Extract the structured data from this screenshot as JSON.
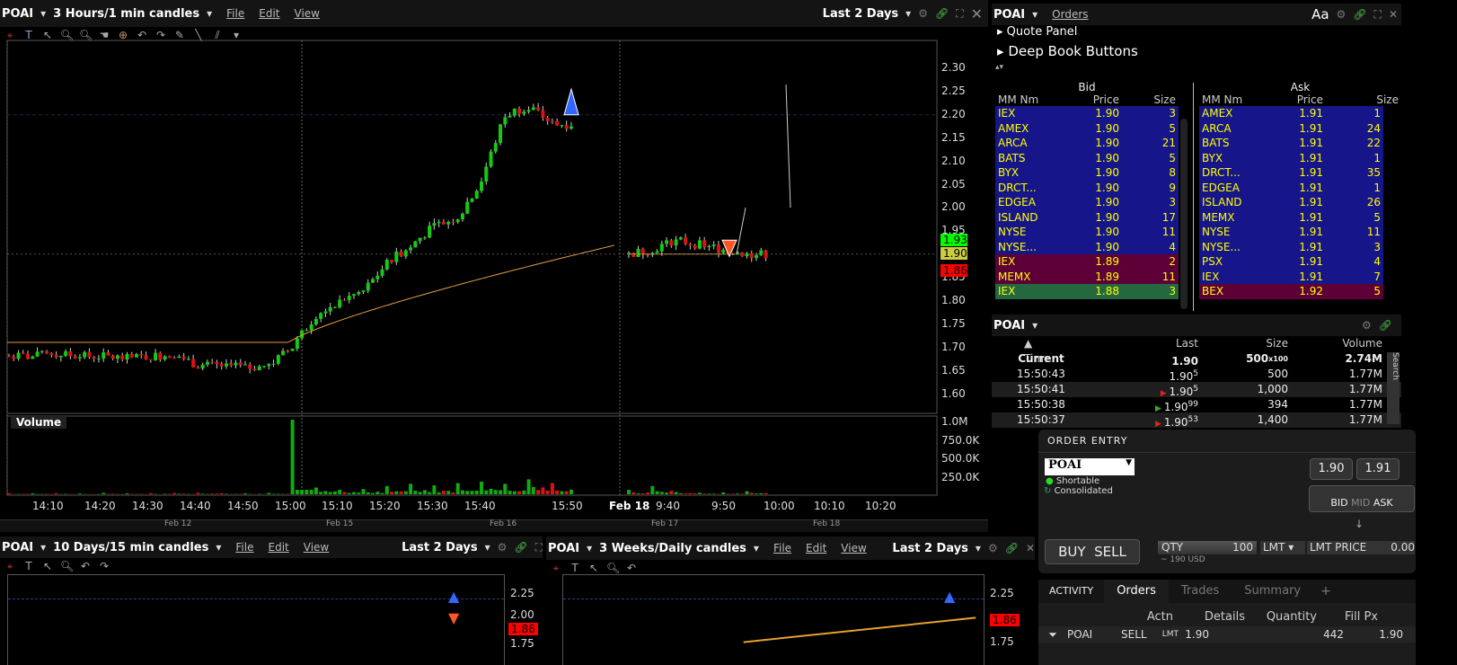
{
  "main_chart": {
    "symbol": "POAI",
    "period": "3 Hours/1 min candles",
    "menu": [
      "File",
      "Edit",
      "View"
    ],
    "range": "Last 2 Days",
    "price_labels": [
      "2.30",
      "2.25",
      "2.20",
      "2.15",
      "2.10",
      "2.05",
      "2.00",
      "1.95",
      "1.90",
      "1.85",
      "1.80",
      "1.75",
      "1.70",
      "1.65",
      "1.60"
    ],
    "tags": {
      "ask": "1.93",
      "last": "1.90",
      "bid": "1.86"
    },
    "volume_label": "Volume",
    "volume_axis": [
      "1.0M",
      "750.0K",
      "500.0K",
      "250.0K"
    ],
    "time_labels": [
      "14:10",
      "14:20",
      "14:30",
      "14:40",
      "14:50",
      "15:00",
      "15:10",
      "15:20",
      "15:30",
      "15:40",
      "15:50",
      "Feb 18",
      "9:40",
      "9:50",
      "10:00",
      "10:10",
      "10:20"
    ],
    "nav_labels": [
      "Feb 12",
      "Feb 15",
      "Feb 16",
      "Feb 17",
      "Feb 18"
    ]
  },
  "chart_data": {
    "type": "candlestick",
    "interval_min": 5,
    "day1": {
      "start": "14:00",
      "closes": [
        1.68,
        1.68,
        1.685,
        1.68,
        1.68,
        1.675,
        1.68,
        1.685,
        1.66,
        1.66,
        1.655,
        1.66,
        1.7,
        1.77,
        1.8,
        1.82,
        1.88,
        1.92,
        1.96,
        1.98,
        2.06,
        2.2,
        2.22,
        2.18
      ]
    },
    "day2": {
      "start": "9:30",
      "closes": [
        1.9,
        1.91,
        1.93,
        1.92,
        1.91,
        1.9
      ]
    },
    "vwap": {
      "day1_start": 1.71,
      "day1_end": 1.92,
      "day2": 1.9
    },
    "volume_k": {
      "day1": [
        15,
        12,
        14,
        10,
        18,
        12,
        14,
        16,
        20,
        14,
        12,
        18,
        1000,
        90,
        60,
        70,
        110,
        140,
        120,
        150,
        170,
        140,
        200,
        150
      ],
      "day2": [
        60,
        110,
        30,
        20,
        25,
        40
      ]
    }
  },
  "book": {
    "symbol": "POAI",
    "orders_link": "Orders",
    "font_btn": "Aa",
    "quote_panel": "Quote Panel",
    "deep_book": "Deep Book Buttons",
    "bid_title": "Bid",
    "ask_title": "Ask",
    "cols": [
      "MM Nm",
      "Price",
      "Size"
    ],
    "bids": [
      [
        "IEX",
        "1.90",
        "3",
        "bl"
      ],
      [
        "AMEX",
        "1.90",
        "5",
        "bl"
      ],
      [
        "ARCA",
        "1.90",
        "21",
        "bl"
      ],
      [
        "BATS",
        "1.90",
        "5",
        "bl"
      ],
      [
        "BYX",
        "1.90",
        "8",
        "bl"
      ],
      [
        "DRCT...",
        "1.90",
        "9",
        "bl"
      ],
      [
        "EDGEA",
        "1.90",
        "3",
        "bl"
      ],
      [
        "ISLAND",
        "1.90",
        "17",
        "bl"
      ],
      [
        "NYSE",
        "1.90",
        "11",
        "bl"
      ],
      [
        "NYSE...",
        "1.90",
        "4",
        "bl"
      ],
      [
        "IEX",
        "1.89",
        "2",
        "mr"
      ],
      [
        "MEMX",
        "1.89",
        "11",
        "mr"
      ],
      [
        "IEX",
        "1.88",
        "3",
        "gr"
      ]
    ],
    "asks": [
      [
        "AMEX",
        "1.91",
        "1",
        "bl"
      ],
      [
        "ARCA",
        "1.91",
        "24",
        "bl"
      ],
      [
        "BATS",
        "1.91",
        "22",
        "bl"
      ],
      [
        "BYX",
        "1.91",
        "1",
        "bl"
      ],
      [
        "DRCT...",
        "1.91",
        "35",
        "bl"
      ],
      [
        "EDGEA",
        "1.91",
        "1",
        "bl"
      ],
      [
        "ISLAND",
        "1.91",
        "26",
        "bl"
      ],
      [
        "MEMX",
        "1.91",
        "5",
        "bl"
      ],
      [
        "NYSE",
        "1.91",
        "11",
        "bl"
      ],
      [
        "NYSE...",
        "1.91",
        "3",
        "bl"
      ],
      [
        "PSX",
        "1.91",
        "4",
        "bl"
      ],
      [
        "IEX",
        "1.91",
        "7",
        "bl"
      ],
      [
        "BEX",
        "1.92",
        "5",
        "mr"
      ]
    ]
  },
  "tns": {
    "symbol": "POAI",
    "cols": [
      "Time",
      "Last",
      "Size",
      "Volume"
    ],
    "search": "Search",
    "rows": [
      [
        "Current",
        "1.90",
        "",
        "500",
        "2.74M"
      ],
      [
        "15:50:43",
        "1.90",
        "5",
        "500",
        "1.77M"
      ],
      [
        "15:50:41",
        "1.90",
        "5",
        "1,000",
        "1.77M"
      ],
      [
        "15:50:38",
        "1.90",
        "99",
        "394",
        "1.77M"
      ],
      [
        "15:50:37",
        "1.90",
        "53",
        "1,400",
        "1.77M"
      ]
    ],
    "current_mult": "x100"
  },
  "order_entry": {
    "title": "ORDER ENTRY",
    "symbol": "POAI",
    "shortable": "Shortable",
    "consolidated": "Consolidated",
    "bid": "1.90",
    "ask": "1.91",
    "scale": [
      "BID",
      "MID",
      "ASK"
    ],
    "buy": "BUY",
    "sell": "SELL",
    "qty_label": "QTY",
    "qty": "100",
    "approx": "~ 190 USD",
    "type": "LMT",
    "lmt_label": "LMT PRICE",
    "lmt": "0.00"
  },
  "activity": {
    "title": "ACTIVITY",
    "tabs": [
      "Orders",
      "Trades",
      "Summary",
      "+"
    ],
    "cols": [
      "Actn",
      "Details",
      "Quantity",
      "Fill Px"
    ],
    "row": {
      "symbol": "POAI",
      "action": "SELL",
      "type": "LMT",
      "price": "1.90",
      "qty": "442",
      "fill": "1.90"
    }
  },
  "chart2": {
    "symbol": "POAI",
    "period": "10 Days/15 min candles",
    "menu": [
      "File",
      "Edit",
      "View"
    ],
    "range": "Last 2 Days",
    "p1": "2.25",
    "p2": "2.00",
    "tag": "1.86",
    "p3": "1.75"
  },
  "chart3": {
    "symbol": "POAI",
    "period": "3 Weeks/Daily candles",
    "menu": [
      "File",
      "Edit",
      "View"
    ],
    "range": "Last 2 Days",
    "p1": "2.25",
    "tag": "1.86",
    "p3": "1.75"
  }
}
